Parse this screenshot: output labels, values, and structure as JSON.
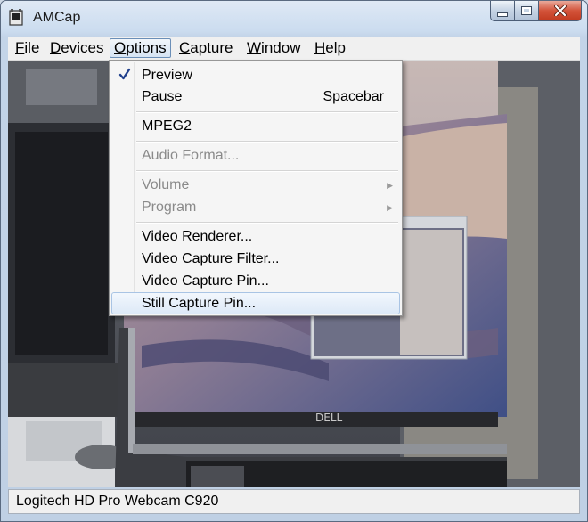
{
  "window": {
    "title": "AMCap"
  },
  "menubar": {
    "items": [
      {
        "label": "File",
        "accel_index": 0
      },
      {
        "label": "Devices",
        "accel_index": 0
      },
      {
        "label": "Options",
        "accel_index": 0
      },
      {
        "label": "Capture",
        "accel_index": 0
      },
      {
        "label": "Window",
        "accel_index": 0
      },
      {
        "label": "Help",
        "accel_index": 0
      }
    ],
    "active": "Options"
  },
  "options_menu": {
    "items": [
      {
        "label": "Preview",
        "checked": true
      },
      {
        "label": "Pause",
        "shortcut": "Spacebar"
      },
      {
        "label": "MPEG2"
      },
      {
        "label": "Audio Format...",
        "disabled": true
      },
      {
        "label": "Volume",
        "disabled": true,
        "submenu": true
      },
      {
        "label": "Program",
        "disabled": true,
        "submenu": true
      },
      {
        "label": "Video Renderer..."
      },
      {
        "label": "Video Capture Filter..."
      },
      {
        "label": "Video Capture Pin..."
      },
      {
        "label": "Still Capture Pin...",
        "highlighted": true
      }
    ]
  },
  "statusbar": {
    "text": "Logitech HD Pro Webcam C920"
  },
  "colors": {
    "close_button": "#c9432a",
    "menu_highlight": "#dde9f7",
    "frame": "#c3d4e8"
  }
}
